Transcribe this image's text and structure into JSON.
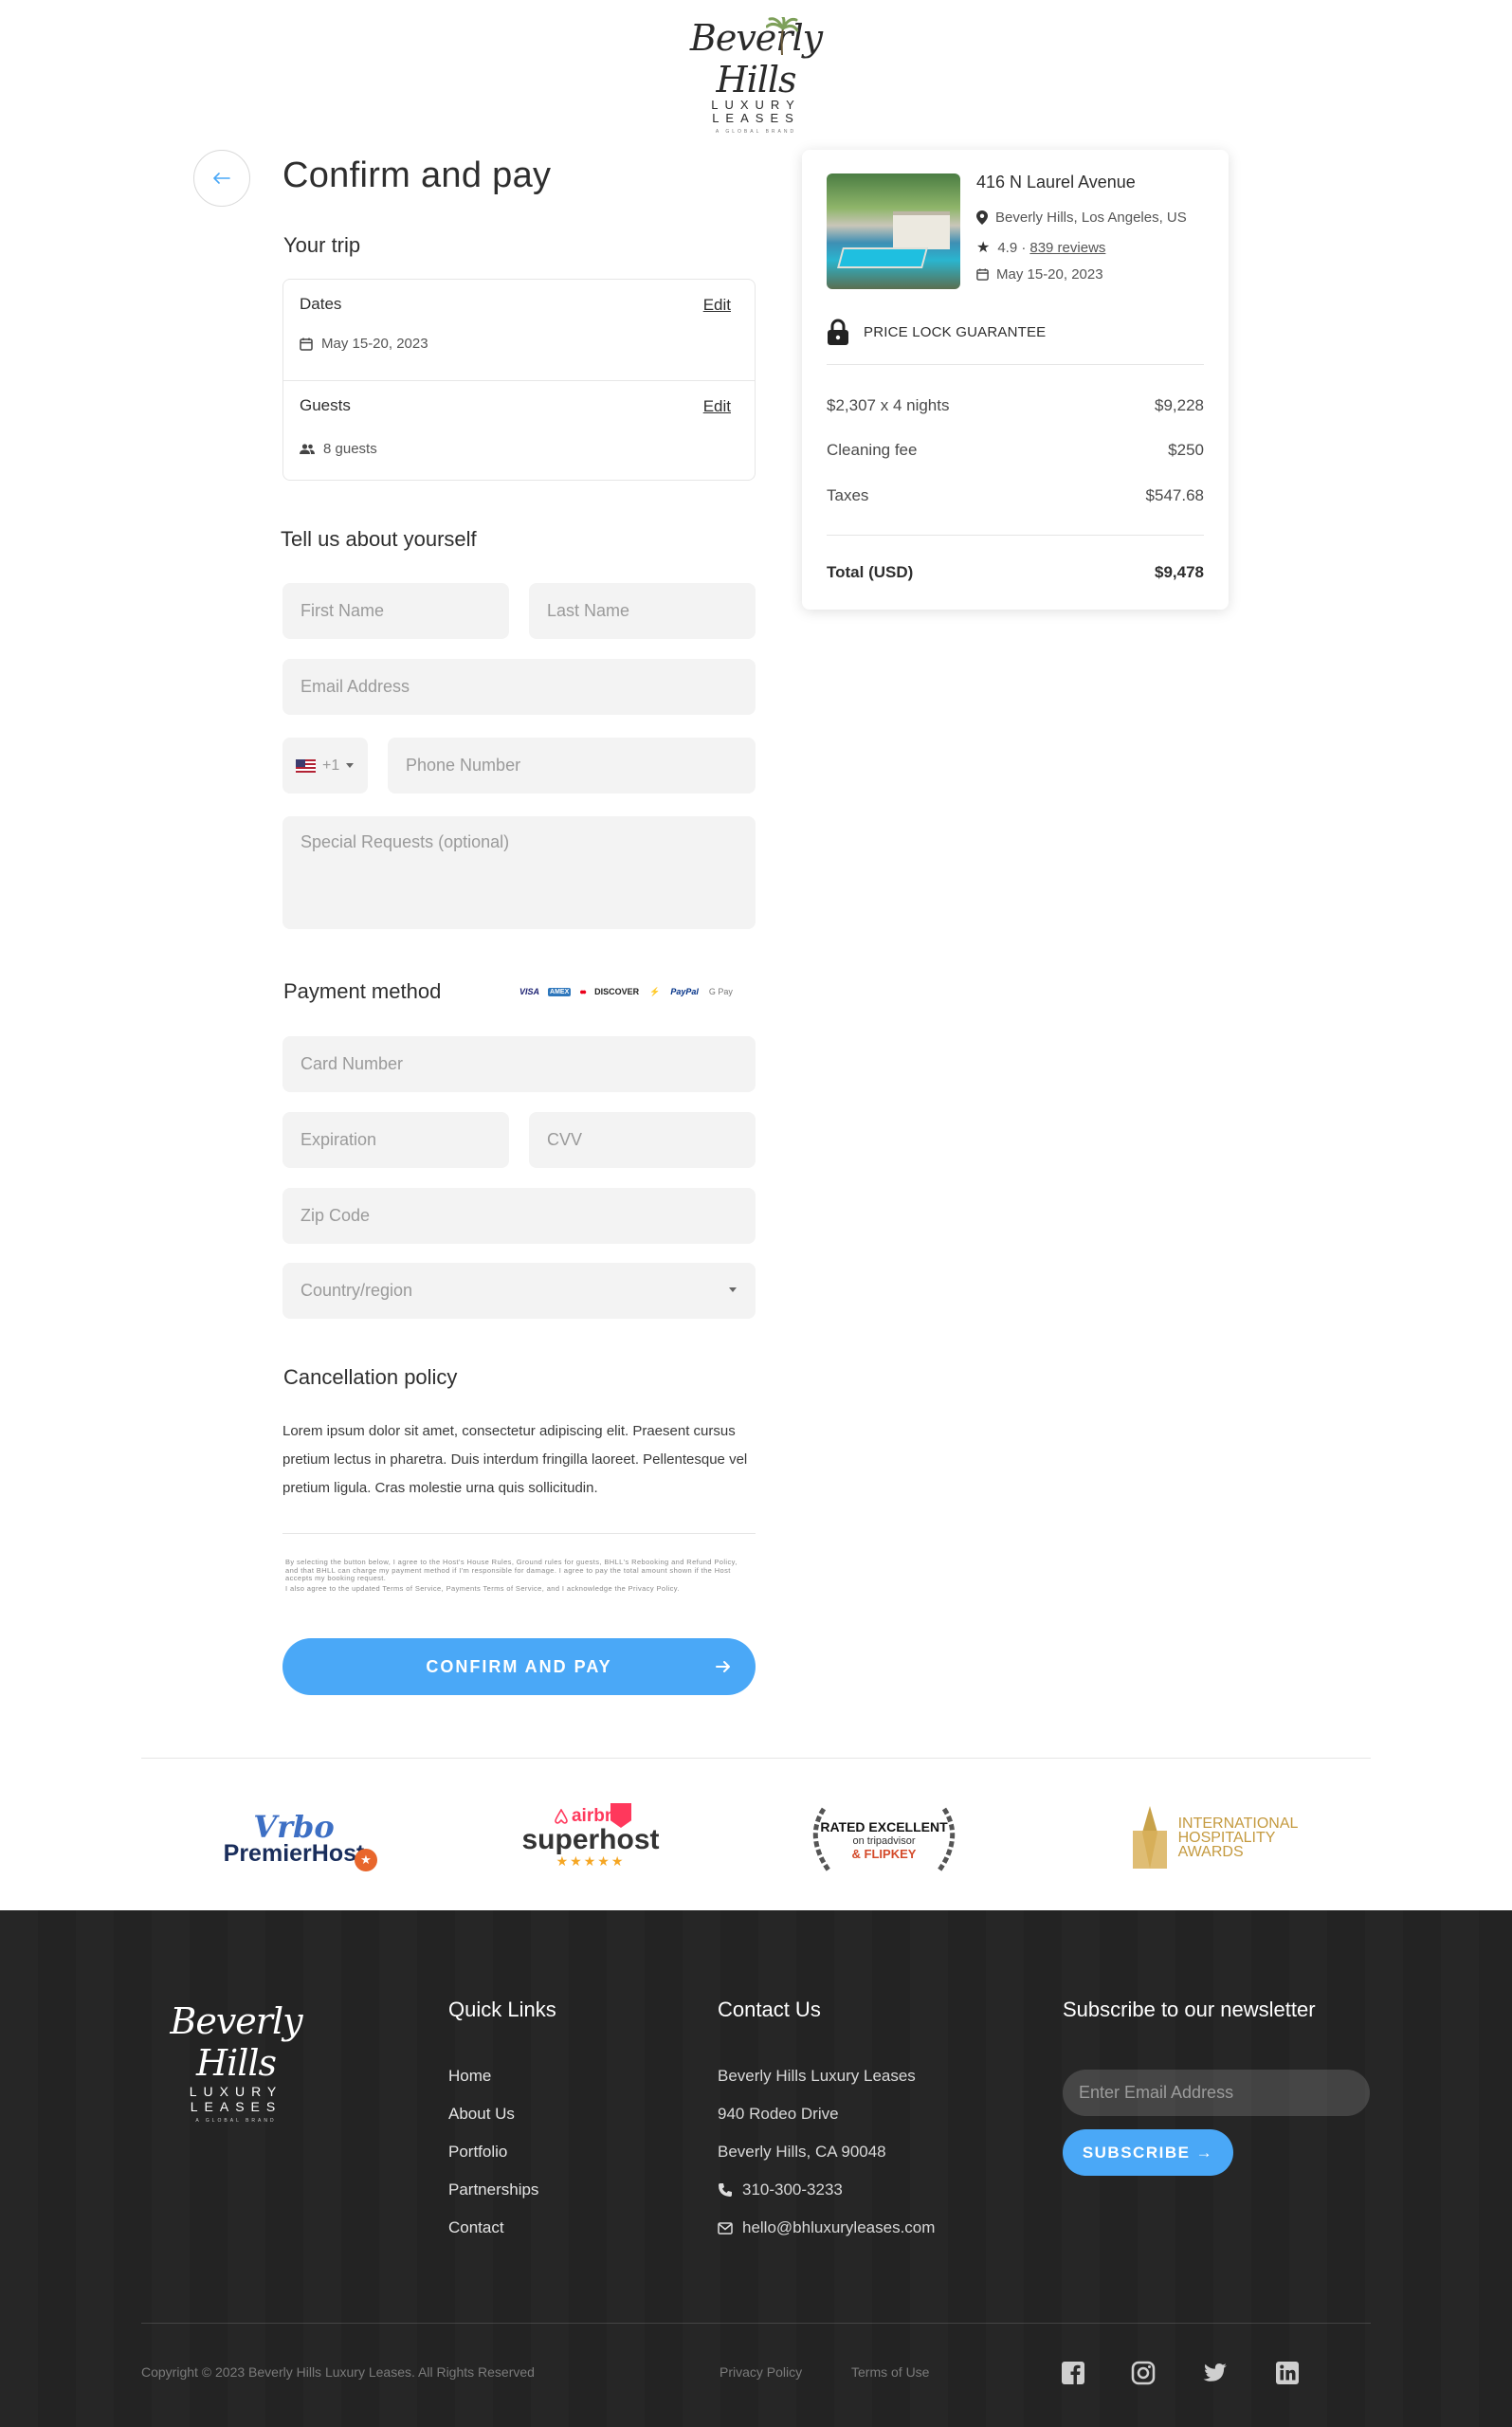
{
  "brand": {
    "logo_script": "Beverly Hills",
    "logo_caps": "LUXURY LEASES",
    "logo_small": "A GLOBAL BRAND"
  },
  "page": {
    "title": "Confirm and pay"
  },
  "trip": {
    "heading": "Your trip",
    "dates_label": "Dates",
    "dates_edit": "Edit",
    "dates_value": "May 15-20, 2023",
    "guests_label": "Guests",
    "guests_edit": "Edit",
    "guests_value": "8 guests"
  },
  "about": {
    "heading": "Tell us about yourself",
    "first_name_placeholder": "First Name",
    "last_name_placeholder": "Last Name",
    "email_placeholder": "Email Address",
    "phone_code": "+1",
    "phone_placeholder": "Phone Number",
    "requests_placeholder": "Special Requests (optional)"
  },
  "payment": {
    "heading": "Payment method",
    "card_brands": [
      "VISA",
      "AMEX",
      "●●",
      "DISCOVER",
      "⚡",
      "PayPal",
      "G Pay"
    ],
    "card_number_placeholder": "Card Number",
    "expiration_placeholder": "Expiration",
    "cvv_placeholder": "CVV",
    "zip_placeholder": "Zip Code",
    "country_placeholder": "Country/region"
  },
  "cancellation": {
    "heading": "Cancellation policy",
    "text": "Lorem ipsum dolor sit amet, consectetur adipiscing elit. Praesent cursus pretium lectus in pharetra. Duis interdum fringilla laoreet. Pellentesque vel pretium ligula. Cras molestie urna quis sollicitudin.",
    "terms_1": "By selecting the button below, I agree to the Host's House Rules, Ground rules for guests, BHLL's Rebooking and Refund Policy, and that BHLL can charge my payment method if I'm responsible for damage. I agree to pay the total amount shown if the Host accepts my booking request.",
    "terms_2": "I also agree to the updated Terms of Service, Payments Terms of Service, and I acknowledge the Privacy Policy."
  },
  "confirm_label": "CONFIRM AND PAY",
  "summary": {
    "property_name": "416 N Laurel Avenue",
    "location": "Beverly Hills, Los Angeles, US",
    "rating": "4.9 ·",
    "reviews": "839 reviews",
    "dates": "May 15-20, 2023",
    "price_lock": "PRICE LOCK GUARANTEE",
    "rows": [
      {
        "label": "$2,307 x 4 nights",
        "amount": "$9,228"
      },
      {
        "label": "Cleaning fee",
        "amount": "$250"
      },
      {
        "label": "Taxes",
        "amount": "$547.68"
      }
    ],
    "total_label": "Total (USD)",
    "total_amount": "$9,478"
  },
  "awards": {
    "vrbo": "Vrbo",
    "vrbo_sub": "PremierHost",
    "airbnb": "airbnb",
    "airbnb_sub": "superhost",
    "airbnb_stars": "★★★★★",
    "trip_top": "RATED EXCELLENT",
    "trip_mid": "on tripadvisor",
    "trip_bottom": "& FLIPKEY",
    "iha_1": "INTERNATIONAL",
    "iha_2": "HOSPITALITY",
    "iha_3": "AWARDS"
  },
  "footer": {
    "quick_links_heading": "Quick Links",
    "quick_links": [
      "Home",
      "About Us",
      "Portfolio",
      "Partnerships",
      "Contact"
    ],
    "contact_heading": "Contact Us",
    "company": "Beverly Hills Luxury Leases",
    "address_1": "940 Rodeo Drive",
    "address_2": "Beverly Hills, CA 90048",
    "phone": "310-300-3233",
    "email": "hello@bhluxuryleases.com",
    "newsletter_heading": "Subscribe to our newsletter",
    "newsletter_placeholder": "Enter Email Address",
    "subscribe_label": "SUBSCRIBE →",
    "copyright": "Copyright © 2023 Beverly Hills Luxury Leases. All Rights Reserved",
    "privacy": "Privacy Policy",
    "terms": "Terms of Use"
  },
  "colors": {
    "accent": "#4aa8f7",
    "footer_bg": "#202020",
    "field_bg": "#f3f3f3"
  }
}
